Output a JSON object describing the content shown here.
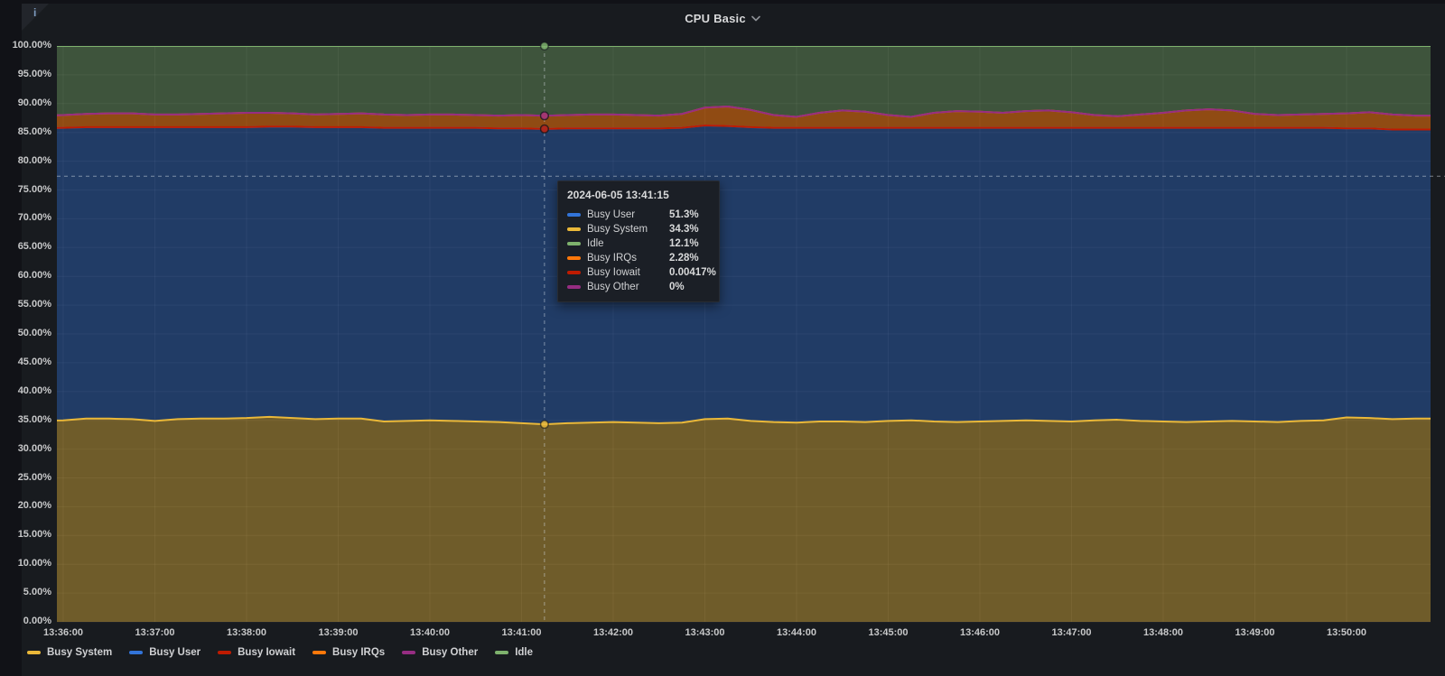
{
  "panel": {
    "title": "CPU Basic",
    "info_badge": "i"
  },
  "tooltip": {
    "title": "2024-06-05 13:41:15",
    "rows": [
      {
        "label": "Busy User",
        "value": "51.3%",
        "color": "#3274D9"
      },
      {
        "label": "Busy System",
        "value": "34.3%",
        "color": "#EAB839"
      },
      {
        "label": "Idle",
        "value": "12.1%",
        "color": "#7EB26D"
      },
      {
        "label": "Busy IRQs",
        "value": "2.28%",
        "color": "#FF780A"
      },
      {
        "label": "Busy Iowait",
        "value": "0.00417%",
        "color": "#BF1B00"
      },
      {
        "label": "Busy Other",
        "value": "0%",
        "color": "#962D82"
      }
    ]
  },
  "chart_data": {
    "type": "area",
    "stacked": true,
    "ylim": [
      0,
      100
    ],
    "grid": true,
    "legend_position": "bottom",
    "x_start_label": "13:35:45",
    "x_step_seconds": 15,
    "x_ticks": [
      "13:36:00",
      "13:37:00",
      "13:38:00",
      "13:39:00",
      "13:40:00",
      "13:41:00",
      "13:42:00",
      "13:43:00",
      "13:44:00",
      "13:45:00",
      "13:46:00",
      "13:47:00",
      "13:48:00",
      "13:49:00",
      "13:50:00"
    ],
    "y_ticks": [
      "0.00%",
      "5.00%",
      "10.00%",
      "15.00%",
      "20.00%",
      "25.00%",
      "30.00%",
      "35.00%",
      "40.00%",
      "45.00%",
      "50.00%",
      "55.00%",
      "60.00%",
      "65.00%",
      "70.00%",
      "75.00%",
      "80.00%",
      "85.00%",
      "90.00%",
      "95.00%",
      "100.00%"
    ],
    "cursor": {
      "index": 22,
      "time_label": "2024-06-05 13:41:15",
      "crosshair_y_percent": 77.4
    },
    "series": [
      {
        "name": "Busy System",
        "color": "#EAB839",
        "fill_opacity": 0.42,
        "values": [
          34.9,
          35.0,
          35.3,
          35.3,
          35.2,
          34.9,
          35.2,
          35.3,
          35.3,
          35.4,
          35.6,
          35.4,
          35.2,
          35.3,
          35.3,
          34.8,
          34.9,
          35.0,
          34.9,
          34.8,
          34.7,
          34.5,
          34.3,
          34.5,
          34.6,
          34.7,
          34.6,
          34.5,
          34.6,
          35.2,
          35.3,
          34.9,
          34.7,
          34.6,
          34.8,
          34.8,
          34.7,
          34.9,
          35.0,
          34.8,
          34.7,
          34.8,
          34.9,
          35.0,
          34.9,
          34.8,
          35.0,
          35.1,
          34.9,
          34.8,
          34.7,
          34.8,
          34.9,
          34.8,
          34.7,
          34.9,
          35.0,
          35.5,
          35.4,
          35.2,
          35.3,
          35.3
        ]
      },
      {
        "name": "Busy User",
        "color": "#3274D9",
        "fill_opacity": 0.38,
        "values": [
          50.8,
          50.8,
          50.6,
          50.6,
          50.7,
          51.0,
          50.7,
          50.6,
          50.6,
          50.5,
          50.4,
          50.6,
          50.7,
          50.6,
          50.6,
          51.0,
          50.9,
          50.8,
          50.9,
          51.0,
          51.0,
          51.2,
          51.3,
          51.2,
          51.1,
          51.0,
          51.1,
          51.2,
          51.2,
          51.0,
          50.8,
          51.0,
          51.1,
          51.2,
          51.0,
          51.0,
          51.1,
          50.9,
          50.8,
          51.0,
          51.1,
          51.0,
          50.9,
          50.8,
          50.9,
          51.0,
          50.8,
          50.7,
          50.9,
          51.0,
          51.1,
          51.0,
          50.9,
          51.0,
          51.1,
          50.9,
          50.8,
          50.2,
          50.3,
          50.3,
          50.2,
          50.2
        ]
      },
      {
        "name": "Busy Iowait",
        "color": "#BF1B00",
        "fill_opacity": 0.35,
        "constant": 0.004
      },
      {
        "name": "Busy IRQs",
        "color": "#FF780A",
        "fill_opacity": 0.52,
        "values": [
          2.2,
          2.2,
          2.3,
          2.4,
          2.4,
          2.2,
          2.2,
          2.3,
          2.4,
          2.5,
          2.4,
          2.3,
          2.2,
          2.3,
          2.4,
          2.3,
          2.2,
          2.3,
          2.3,
          2.2,
          2.2,
          2.3,
          2.28,
          2.3,
          2.4,
          2.4,
          2.3,
          2.2,
          2.4,
          3.1,
          3.4,
          3.0,
          2.2,
          1.9,
          2.6,
          3.0,
          2.8,
          2.2,
          1.9,
          2.6,
          2.9,
          2.8,
          2.6,
          2.9,
          3.0,
          2.7,
          2.2,
          2.0,
          2.3,
          2.6,
          3.0,
          3.2,
          3.0,
          2.4,
          2.2,
          2.3,
          2.4,
          2.6,
          2.8,
          2.6,
          2.4,
          2.4
        ]
      },
      {
        "name": "Busy Other",
        "color": "#962D82",
        "fill_opacity": 0.35,
        "constant": 0
      },
      {
        "name": "Idle",
        "color": "#7EB26D",
        "fill_opacity": 0.38,
        "remainder": true
      }
    ]
  }
}
